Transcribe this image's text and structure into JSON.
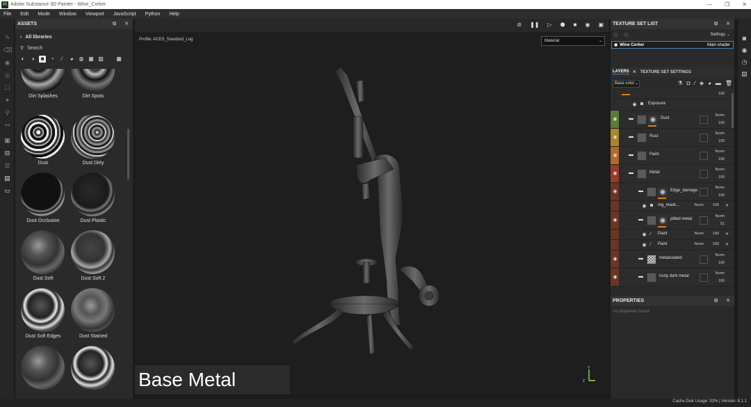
{
  "window": {
    "title": "Adobe Substance 3D Painter - Wine_Corker",
    "app_icon": "Pt",
    "minimize": "—",
    "restore": "❐",
    "close": "✕"
  },
  "menu": [
    "File",
    "Edit",
    "Mode",
    "Window",
    "Viewport",
    "JavaScript",
    "Python",
    "Help"
  ],
  "assets": {
    "title": "ASSETS",
    "library": "All libraries",
    "search_placeholder": "Search",
    "items": [
      {
        "label": "Dirt Splashes",
        "style": "splash"
      },
      {
        "label": "Dirt Spots",
        "style": "spots"
      },
      {
        "label": "Dust",
        "style": "dust"
      },
      {
        "label": "Dust Dirty",
        "style": "dirty"
      },
      {
        "label": "Dust Occlusion",
        "style": "occl"
      },
      {
        "label": "Dust Plastic",
        "style": "plastic"
      },
      {
        "label": "Dust Soft",
        "style": "soft"
      },
      {
        "label": "Dust Soft 2",
        "style": "soft2"
      },
      {
        "label": "Dust Soft Edges",
        "style": "edges"
      },
      {
        "label": "Dust Stained",
        "style": "stained"
      },
      {
        "label": "",
        "style": "soft"
      },
      {
        "label": "",
        "style": "edges"
      }
    ]
  },
  "viewport": {
    "profile": "Profile: ACES_Standard_Log",
    "material_select": "Material",
    "caption": "Base Metal",
    "axis_y": "Y",
    "axis_z": "Z"
  },
  "texture_set_list": {
    "title": "TEXTURE SET LIST",
    "settings": "Settings",
    "set_name": "Wine Corker",
    "shader": "Main shader"
  },
  "layers_tabs": {
    "layers": "LAYERS",
    "texture_set_settings": "TEXTURE SET SETTINGS",
    "channel": "Base color"
  },
  "layers": [
    {
      "name": "",
      "kind": "partial",
      "opacity": "100",
      "color": "",
      "level": 1
    },
    {
      "name": "Exposure",
      "kind": "filter",
      "opacity": "",
      "color": "",
      "level": 1
    },
    {
      "name": "Dust",
      "kind": "fill",
      "blend": "Norm",
      "opacity": "100",
      "color": "#5b7a3a",
      "level": 0
    },
    {
      "name": "Rust",
      "kind": "folder",
      "blend": "Norm",
      "opacity": "100",
      "color": "#a8862a",
      "level": 0
    },
    {
      "name": "Paint",
      "kind": "folder",
      "blend": "Norm",
      "opacity": "100",
      "color": "#b06a2a",
      "level": 0
    },
    {
      "name": "Metal",
      "kind": "folder",
      "blend": "Norm",
      "opacity": "100",
      "color": "#9a3a2a",
      "level": 0
    },
    {
      "name": "Edge_damage",
      "kind": "fill",
      "blend": "Norm",
      "opacity": "100",
      "color": "#6a3524",
      "level": 1
    },
    {
      "name": "mg_mask...",
      "kind": "effect",
      "blend": "Norm",
      "opacity": "100",
      "color": "#6a3524",
      "level": 2
    },
    {
      "name": "pitted metal",
      "kind": "fill",
      "blend": "Norm",
      "opacity": "51",
      "color": "#6a3524",
      "level": 1
    },
    {
      "name": "Paint",
      "kind": "paint",
      "blend": "Norm",
      "opacity": "100",
      "color": "#6a3524",
      "level": 2
    },
    {
      "name": "Paint",
      "kind": "paint",
      "blend": "Norm",
      "opacity": "100",
      "color": "#6a3524",
      "level": 2
    },
    {
      "name": "metalcoated",
      "kind": "fill",
      "blend": "Norm",
      "opacity": "100",
      "color": "#6a3524",
      "level": 1
    },
    {
      "name": "rusty dark metal",
      "kind": "fill",
      "blend": "Norm",
      "opacity": "100",
      "color": "#6a3524",
      "level": 1
    }
  ],
  "properties": {
    "title": "PROPERTIES",
    "empty": "no properties found"
  },
  "status": {
    "text": "Cache Disk Usage:   92% | Version: 8.1.1"
  },
  "colors": {
    "accent": "#4a7fb8",
    "orange": "#e07a20"
  }
}
